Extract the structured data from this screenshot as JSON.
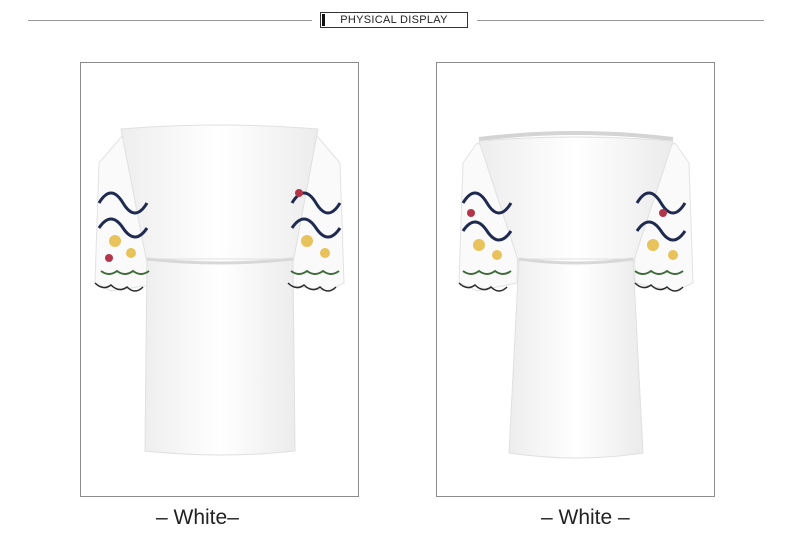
{
  "header": {
    "title": "PHYSICAL DISPLAY"
  },
  "products": [
    {
      "caption": "– White–"
    },
    {
      "caption": "– White –"
    }
  ]
}
